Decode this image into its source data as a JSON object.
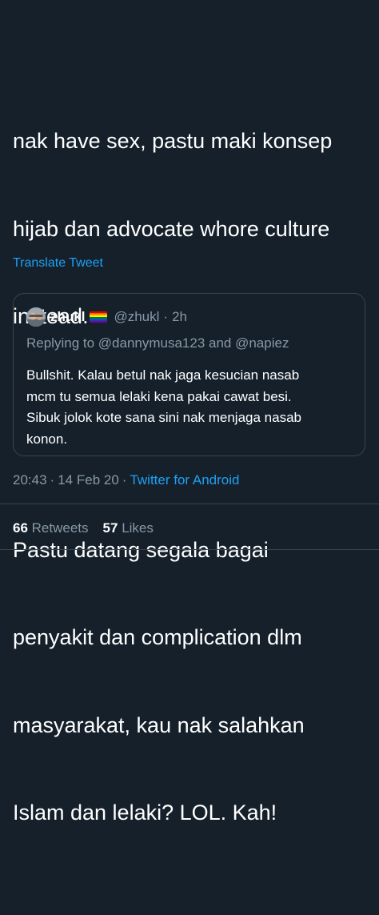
{
  "tweet": {
    "body_lines_p1": [
      "nak have sex, pastu maki konsep",
      "hijab dan advocate whore culture",
      "instead."
    ],
    "body_lines_p2": [
      "Pastu datang segala bagai",
      "penyakit dan complication dlm",
      "masyarakat, kau nak salahkan",
      "Islam dan lelaki? LOL. Kah!"
    ],
    "translate_label": "Translate Tweet"
  },
  "quote": {
    "name": "zhukl",
    "flag_icon": "rainbow-flag-icon",
    "handle": "@zhukl",
    "dot": "·",
    "time": "2h",
    "replying": "Replying to @dannymusa123 and @napiez",
    "text_lines": [
      "Bullshit. Kalau betul nak jaga kesucian nasab",
      "mcm tu semua lelaki kena pakai cawat besi.",
      "Sibuk jolok kote sana sini nak menjaga nasab",
      "konon."
    ]
  },
  "meta": {
    "time": "20:43",
    "sep1": "·",
    "date": "14 Feb 20",
    "sep2": "·",
    "source": "Twitter for Android"
  },
  "stats": {
    "retweets_count": "66",
    "retweets_label": "Retweets",
    "likes_count": "57",
    "likes_label": "Likes"
  },
  "colors": {
    "background": "#15202b",
    "link": "#1da1f2",
    "secondary_text": "#8899a6",
    "border": "#38444d"
  }
}
